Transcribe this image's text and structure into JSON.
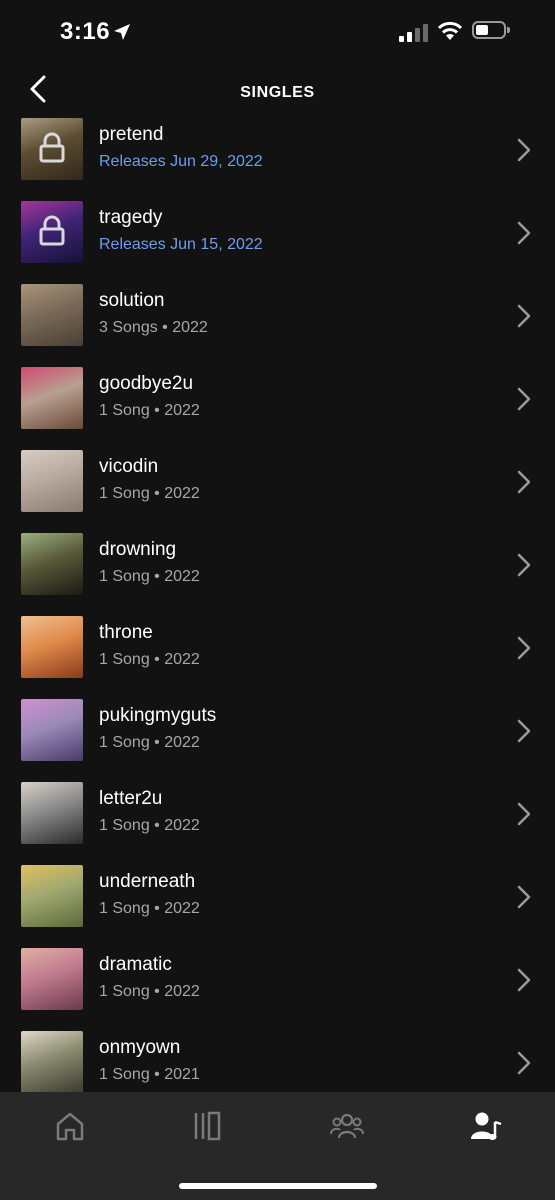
{
  "status_bar": {
    "time": "3:16"
  },
  "header": {
    "title": "SINGLES"
  },
  "singles": [
    {
      "name": "pretend",
      "subtitle": "Releases Jun 29, 2022",
      "locked": true,
      "art": [
        "#3a2e1f",
        "#6b5a3a",
        "#c8b89a"
      ]
    },
    {
      "name": "tragedy",
      "subtitle": "Releases Jun 15, 2022",
      "locked": true,
      "art": [
        "#1a1440",
        "#4a2a8a",
        "#c23fb5"
      ]
    },
    {
      "name": "solution",
      "subtitle": "3 Songs • 2022",
      "locked": false,
      "art": [
        "#4a3f35",
        "#7a6a58",
        "#a8957a"
      ]
    },
    {
      "name": "goodbye2u",
      "subtitle": "1 Song • 2022",
      "locked": false,
      "art": [
        "#6a4a3a",
        "#b8a090",
        "#d04a70"
      ]
    },
    {
      "name": "vicodin",
      "subtitle": "1 Song • 2022",
      "locked": false,
      "art": [
        "#8a7a70",
        "#b8aaa0",
        "#d8ccc4"
      ]
    },
    {
      "name": "drowning",
      "subtitle": "1 Song • 2022",
      "locked": false,
      "art": [
        "#1a1a14",
        "#5a5a3a",
        "#9ab080"
      ]
    },
    {
      "name": "throne",
      "subtitle": "1 Song • 2022",
      "locked": false,
      "art": [
        "#8a3a1a",
        "#e08a4a",
        "#f0c090"
      ]
    },
    {
      "name": "pukingmyguts",
      "subtitle": "1 Song • 2022",
      "locked": false,
      "art": [
        "#4a3a6a",
        "#9a8ab8",
        "#d090d0"
      ]
    },
    {
      "name": "letter2u",
      "subtitle": "1 Song • 2022",
      "locked": false,
      "art": [
        "#2a2a2a",
        "#8a8a8a",
        "#d8d0c8"
      ]
    },
    {
      "name": "underneath",
      "subtitle": "1 Song • 2022",
      "locked": false,
      "art": [
        "#5a6a3a",
        "#a0a870",
        "#e0c060"
      ]
    },
    {
      "name": "dramatic",
      "subtitle": "1 Song • 2022",
      "locked": false,
      "art": [
        "#6a3a4a",
        "#c07a90",
        "#e0b0a0"
      ]
    },
    {
      "name": "onmyown",
      "subtitle": "1 Song • 2021",
      "locked": false,
      "art": [
        "#3a3a30",
        "#8a8a70",
        "#e0d8c8"
      ]
    }
  ],
  "tabs": [
    {
      "name": "home",
      "icon": "home-icon"
    },
    {
      "name": "library",
      "icon": "library-icon"
    },
    {
      "name": "fans",
      "icon": "people-icon"
    },
    {
      "name": "profile",
      "icon": "artist-profile-icon"
    }
  ],
  "colors": {
    "background": "#121212",
    "release_accent": "#6e9df0",
    "secondary_text": "#a7a7a7",
    "tab_bar": "#282828"
  }
}
